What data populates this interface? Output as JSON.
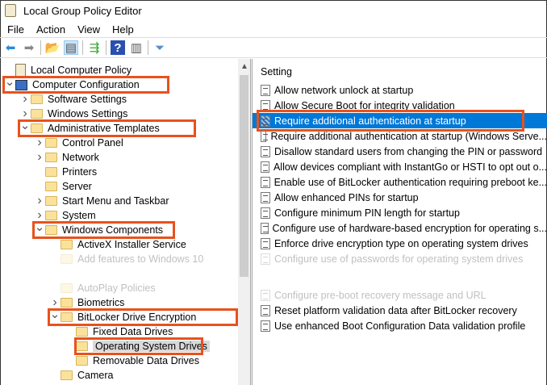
{
  "window": {
    "title": "Local Group Policy Editor"
  },
  "menu": [
    "File",
    "Action",
    "View",
    "Help"
  ],
  "toolbar": [
    {
      "icon": "back-arrow-icon",
      "glyph": "⬅",
      "color": "#2b8ad8"
    },
    {
      "icon": "forward-arrow-icon",
      "glyph": "➡",
      "color": "#888"
    },
    {
      "icon": "up-folder-icon",
      "glyph": "📂",
      "color": "#c9a030"
    },
    {
      "icon": "show-hide-tree-icon",
      "glyph": "▤",
      "color": "#555"
    },
    {
      "icon": "export-list-icon",
      "glyph": "⇶",
      "color": "#3a3"
    },
    {
      "icon": "help-icon",
      "glyph": "?",
      "color": "#fff"
    },
    {
      "icon": "show-action-pane-icon",
      "glyph": "▥",
      "color": "#555"
    },
    {
      "icon": "filter-icon",
      "glyph": "⏷",
      "color": "#5a8fc0"
    }
  ],
  "tree": [
    {
      "label": "Local Computer Policy",
      "depth": 0,
      "icon": "doc",
      "chev": ""
    },
    {
      "label": "Computer Configuration",
      "depth": 0,
      "icon": "pc",
      "chev": "v",
      "boxed": true
    },
    {
      "label": "Software Settings",
      "depth": 1,
      "icon": "folder",
      "chev": ">"
    },
    {
      "label": "Windows Settings",
      "depth": 1,
      "icon": "folder",
      "chev": ">"
    },
    {
      "label": "Administrative Templates",
      "depth": 1,
      "icon": "folder",
      "chev": "v",
      "boxed": true
    },
    {
      "label": "Control Panel",
      "depth": 2,
      "icon": "folder",
      "chev": ">"
    },
    {
      "label": "Network",
      "depth": 2,
      "icon": "folder",
      "chev": ">"
    },
    {
      "label": "Printers",
      "depth": 2,
      "icon": "folder",
      "chev": ""
    },
    {
      "label": "Server",
      "depth": 2,
      "icon": "folder",
      "chev": ""
    },
    {
      "label": "Start Menu and Taskbar",
      "depth": 2,
      "icon": "folder",
      "chev": ">"
    },
    {
      "label": "System",
      "depth": 2,
      "icon": "folder",
      "chev": ">"
    },
    {
      "label": "Windows Components",
      "depth": 2,
      "icon": "folder",
      "chev": "v",
      "boxed": true
    },
    {
      "label": "ActiveX Installer Service",
      "depth": 3,
      "icon": "folder",
      "chev": ""
    },
    {
      "label": "Add features to Windows 10",
      "depth": 3,
      "icon": "folder",
      "chev": "",
      "faded": true
    },
    {
      "label": "",
      "depth": 3,
      "icon": "",
      "chev": ""
    },
    {
      "label": "AutoPlay Policies",
      "depth": 3,
      "icon": "folder",
      "chev": "",
      "faded": true
    },
    {
      "label": "Biometrics",
      "depth": 3,
      "icon": "folder",
      "chev": ">"
    },
    {
      "label": "BitLocker Drive Encryption",
      "depth": 3,
      "icon": "folder",
      "chev": "v",
      "boxed": true
    },
    {
      "label": "Fixed Data Drives",
      "depth": 4,
      "icon": "folder",
      "chev": ""
    },
    {
      "label": "Operating System Drives",
      "depth": 4,
      "icon": "folder",
      "chev": "",
      "boxed": true,
      "selected": true
    },
    {
      "label": "Removable Data Drives",
      "depth": 4,
      "icon": "folder",
      "chev": ""
    },
    {
      "label": "Camera",
      "depth": 3,
      "icon": "folder",
      "chev": ""
    }
  ],
  "settings": {
    "header": "Setting",
    "rows": [
      {
        "label": "Allow network unlock at startup"
      },
      {
        "label": "Allow Secure Boot for integrity validation"
      },
      {
        "label": "Require additional authentication at startup",
        "selected": true
      },
      {
        "label": "Require additional authentication at startup (Windows Serve..."
      },
      {
        "label": "Disallow standard users from changing the PIN or password"
      },
      {
        "label": "Allow devices compliant with InstantGo or HSTI to opt out o..."
      },
      {
        "label": "Enable use of BitLocker authentication requiring preboot ke..."
      },
      {
        "label": "Allow enhanced PINs for startup"
      },
      {
        "label": "Configure minimum PIN length for startup"
      },
      {
        "label": "Configure use of hardware-based encryption for operating s..."
      },
      {
        "label": "Enforce drive encryption type on operating system drives"
      },
      {
        "label": "Configure use of passwords for operating system drives",
        "faded": true
      },
      {
        "label": "",
        "blank": true
      },
      {
        "label": "Configure pre-boot recovery message and URL",
        "faded": true
      },
      {
        "label": "Reset platform validation data after BitLocker recovery"
      },
      {
        "label": "Use enhanced Boot Configuration Data validation profile"
      }
    ]
  },
  "colors": {
    "highlight": "#0078d7",
    "annotation": "#e8521c"
  }
}
